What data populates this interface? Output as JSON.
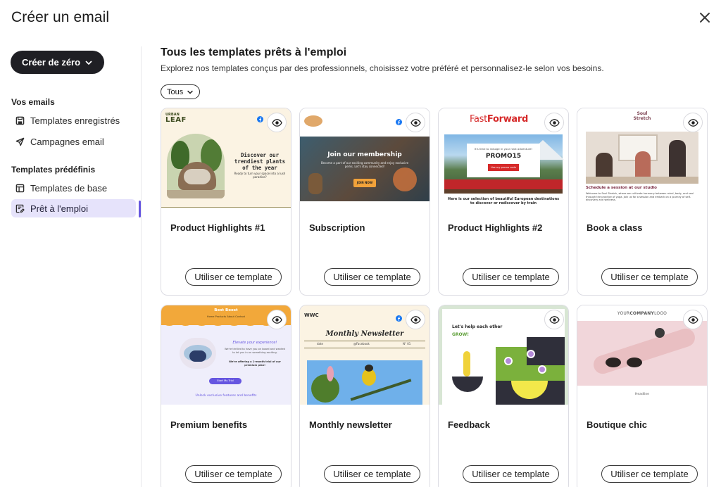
{
  "modal": {
    "title": "Créer un email",
    "close_icon": "close-icon"
  },
  "sidebar": {
    "create_label": "Créer de zéro",
    "section_emails": "Vos emails",
    "items_emails": [
      {
        "label": "Templates enregistrés",
        "icon": "save-icon"
      },
      {
        "label": "Campagnes email",
        "icon": "send-icon"
      }
    ],
    "section_predefined": "Templates prédéfinis",
    "items_predefined": [
      {
        "label": "Templates de base",
        "icon": "layout-icon"
      },
      {
        "label": "Prêt à l'emploi",
        "icon": "template-edit-icon",
        "active": true
      }
    ]
  },
  "main": {
    "title": "Tous les templates prêts à l'emploi",
    "subtitle": "Explorez nos templates conçus par des professionnels, choisissez votre préféré et personnalisez-le selon vos besoins.",
    "filter": "Tous",
    "use_label": "Utiliser ce template",
    "cards": [
      {
        "title": "Product Highlights #1",
        "thumb": {
          "logo_top": "URBAN",
          "logo_bottom": "LEAF",
          "headline": "Discover our trendiest plants of the year",
          "body": "Ready to turn your space into a lush paradise?"
        }
      },
      {
        "title": "Subscription",
        "thumb": {
          "headline": "Join our membership",
          "body": "Become a part of our exciting community and enjoy exclusive perks. Let's stay connected!",
          "cta": "JOIN NOW"
        }
      },
      {
        "title": "Product Highlights #2",
        "thumb": {
          "logo_a": "Fast",
          "logo_b": "Forward",
          "promo_line": "It's time to indulge in your next adventure!",
          "code": "PROMO15",
          "cta": "Use my promo code",
          "caption": "Here is our selection of beautiful European destinations to discover or rediscover by train"
        }
      },
      {
        "title": "Book a class",
        "thumb": {
          "logo_top": "Soul",
          "logo_bottom": "Stretch",
          "headline": "Schedule a session at our studio",
          "body": "Welcome to Soul Stretch, where we cultivate harmony between mind, body, and soul through the practice of yoga. Join us for a session and embark on a journey of self-discovery and wellness."
        }
      },
      {
        "title": "Premium benefits",
        "thumb": {
          "logo": "Best Boost",
          "nav": "Home  Products  About  Contact",
          "headline": "Elevate your experience!",
          "body": "We're thrilled to have you on board and wanted to let you in on something exciting.",
          "offer": "We're offering a 1-month trial of our premium plan!",
          "cta": "Start My Trial",
          "footer": "Unlock exclusive features and benefits"
        }
      },
      {
        "title": "Monthly newsletter",
        "thumb": {
          "logo": "WWC",
          "headline": "Monthly Newsletter",
          "date": "date",
          "handle": "@Facebook",
          "issue": "N° 01"
        }
      },
      {
        "title": "Feedback",
        "thumb": {
          "headline": "Let's help each other",
          "accent": "GROW!"
        }
      },
      {
        "title": "Boutique chic",
        "thumb": {
          "logo_a": "YOUR",
          "logo_b": "COMPANY",
          "logo_c": "LOGO",
          "caption": "Headline"
        }
      }
    ]
  },
  "colors": {
    "accent": "#6656e0",
    "active_bg": "#e6e3fb",
    "dark_button": "#1f1f24"
  },
  "icons": {
    "eye": "eye-icon",
    "chevron": "chevron-down-icon",
    "facebook": "facebook-icon"
  }
}
